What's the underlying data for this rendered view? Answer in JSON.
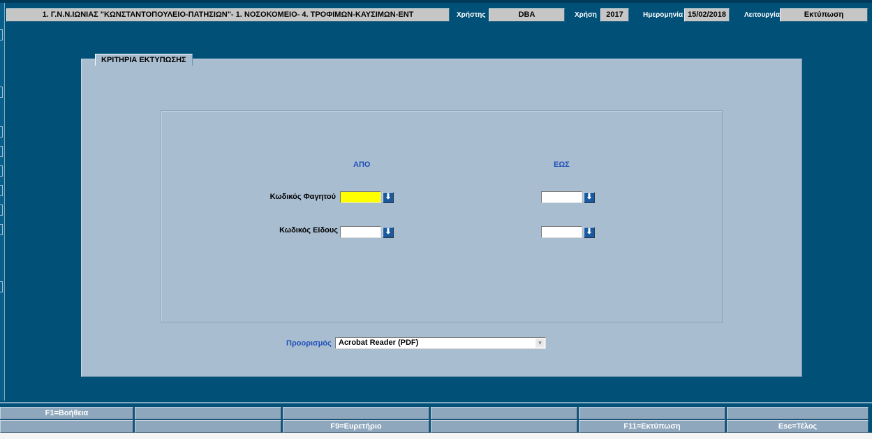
{
  "header": {
    "org_title": "1. Γ.Ν.Ν.ΙΩΝΙΑΣ \"ΚΩΝΣΤΑΝΤΟΠΟΥΛΕΙΟ-ΠΑΤΗΣΙΩΝ\"- 1. ΝΟΣΟΚΟΜΕΙΟ- 4. ΤΡΟΦΙΜΩΝ-ΚΑΥΣΙΜΩΝ-ΕΝΤ",
    "user_label": "Χρήστης",
    "user_value": "DBA",
    "year_label": "Χρήση",
    "year_value": "2017",
    "date_label": "Ημερομηνία",
    "date_value": "15/02/2018",
    "function_label": "Λειτουργία",
    "function_value": "Εκτύπωση"
  },
  "panel": {
    "title": "ΚΡΙΤΗΡΙΑ ΕΚΤΥΠΩΣΗΣ",
    "from_label": "ΑΠΟ",
    "to_label": "ΕΩΣ",
    "rows": [
      {
        "label": "Κωδικός Φαγητού",
        "from_value": "",
        "to_value": ""
      },
      {
        "label": "Κωδικός Είδους",
        "from_value": "",
        "to_value": ""
      }
    ],
    "destination_label": "Προορισμός",
    "destination_value": "Acrobat Reader (PDF)"
  },
  "function_keys": {
    "row1": [
      "F1=Βοήθεια",
      "",
      "",
      "",
      "",
      ""
    ],
    "row2": [
      "",
      "",
      "F9=Ευρετήριο",
      "",
      "F11=Εκτύπωση",
      "Esc=Τέλος"
    ]
  },
  "colors": {
    "background": "#005078",
    "panel": "#a9bdd1",
    "focused_input": "#ffff00",
    "label_blue": "#1f4fb8"
  },
  "icons": {
    "lov_button": "arrow-down-icon",
    "select_arrow": "dropdown-arrow-icon"
  }
}
